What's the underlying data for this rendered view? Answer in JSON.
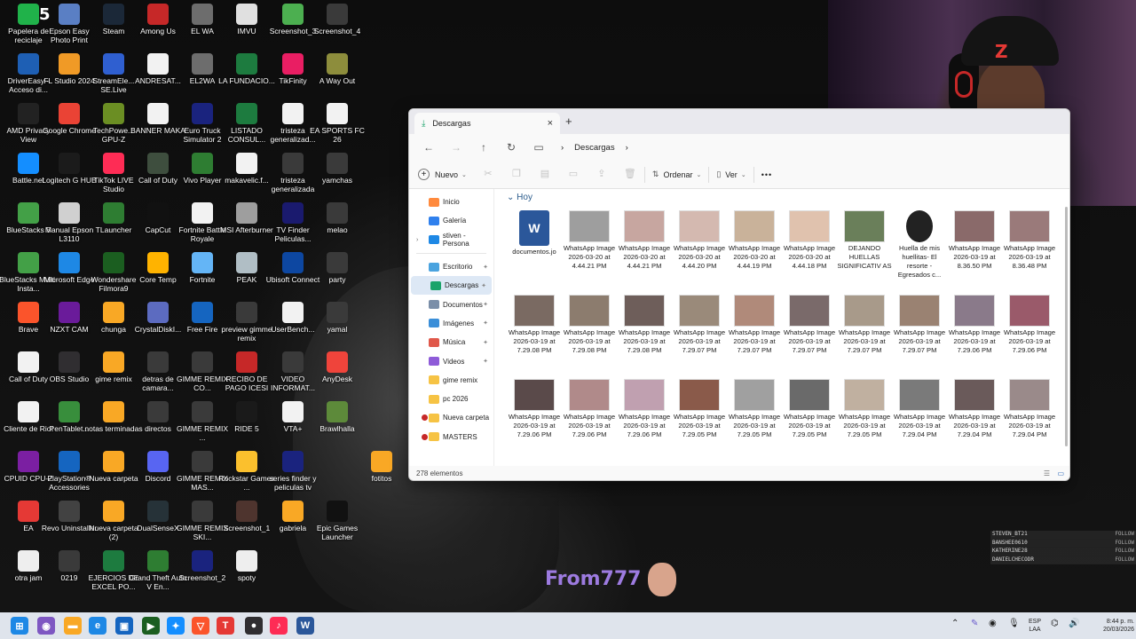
{
  "desktop": {
    "icons": [
      {
        "label": "Papelera de reciclaje",
        "badge": "5",
        "color": "#20b24a"
      },
      {
        "label": "Epson Easy Photo Print",
        "color": "#5a7fc4"
      },
      {
        "label": "Steam",
        "color": "#1b2838"
      },
      {
        "label": "Among Us",
        "color": "#c62828"
      },
      {
        "label": "EL WA",
        "color": "#6d6d6d"
      },
      {
        "label": "IMVU",
        "color": "#e0e0e0"
      },
      {
        "label": "Screenshot_3",
        "color": "#4caf50"
      },
      {
        "label": "Screenshot_4",
        "color": "#3a3a3a"
      },
      {
        "label": "DriverEasy - Acceso di...",
        "color": "#1e5fb4"
      },
      {
        "label": "FL Studio 2024",
        "color": "#f09a26"
      },
      {
        "label": "StreamEle... SE.Live",
        "color": "#2f5fd0"
      },
      {
        "label": "ANDRESAT...",
        "color": "#f2f2f2"
      },
      {
        "label": "EL2WA",
        "color": "#6d6d6d"
      },
      {
        "label": "LA FUNDACIO...",
        "color": "#1d7b3f"
      },
      {
        "label": "TikFinity",
        "color": "#e91e63"
      },
      {
        "label": "A Way Out",
        "color": "#8d8d3c"
      },
      {
        "label": "AMD Privacy View",
        "color": "#222222"
      },
      {
        "label": "Google Chrome",
        "color": "#ea4335"
      },
      {
        "label": "TechPowe... GPU-Z",
        "color": "#6b8e23"
      },
      {
        "label": "BANNER MAKA",
        "color": "#f2f2f2"
      },
      {
        "label": "Euro Truck Simulator 2",
        "color": "#1a237e"
      },
      {
        "label": "LISTADO CONSUL...",
        "color": "#1d7b3f"
      },
      {
        "label": "tristeza generalizad...",
        "color": "#f2f2f2"
      },
      {
        "label": "EA SPORTS FC 26",
        "color": "#f2f2f2"
      },
      {
        "label": "Battle.net",
        "color": "#148eff"
      },
      {
        "label": "Logitech G HUB",
        "color": "#1b1b1b"
      },
      {
        "label": "TikTok LIVE Studio",
        "color": "#fe2c55"
      },
      {
        "label": "Call of Duty",
        "color": "#3e4e3e"
      },
      {
        "label": "Vivo Player",
        "color": "#2e7d32"
      },
      {
        "label": "makavelic.f...",
        "color": "#f2f2f2"
      },
      {
        "label": "tristeza generalizada",
        "color": "#3a3a3a"
      },
      {
        "label": "yamchas",
        "color": "#3a3a3a"
      },
      {
        "label": "BlueStacks 5",
        "color": "#43a047"
      },
      {
        "label": "Manual Epson L3110",
        "color": "#d0d0d0"
      },
      {
        "label": "TLauncher",
        "color": "#2e7d32"
      },
      {
        "label": "CapCut",
        "color": "#111111"
      },
      {
        "label": "Fortnite Battle Royale",
        "color": "#f2f2f2"
      },
      {
        "label": "MSI Afterburner",
        "color": "#9e9e9e"
      },
      {
        "label": "TV Finder Peliculas...",
        "color": "#1a1a6e"
      },
      {
        "label": "melao",
        "color": "#3a3a3a"
      },
      {
        "label": "BlueStacks Multi-Insta...",
        "color": "#43a047"
      },
      {
        "label": "Microsoft Edge",
        "color": "#1e88e5"
      },
      {
        "label": "Wondershare Filmora9",
        "color": "#1b5e20"
      },
      {
        "label": "Core Temp",
        "color": "#ffb300"
      },
      {
        "label": "Fortnite",
        "color": "#64b5f6"
      },
      {
        "label": "PEAK",
        "color": "#b0bec5"
      },
      {
        "label": "Ubisoft Connect",
        "color": "#0d47a1"
      },
      {
        "label": "party",
        "color": "#3a3a3a"
      },
      {
        "label": "Brave",
        "color": "#fb542b"
      },
      {
        "label": "NZXT CAM",
        "color": "#6a1b9a"
      },
      {
        "label": "chunga",
        "color": "#f9a825"
      },
      {
        "label": "CrystalDiskI...",
        "color": "#5c6bc0"
      },
      {
        "label": "Free Fire",
        "color": "#1565c0"
      },
      {
        "label": "preview gimme remix",
        "color": "#3a3a3a"
      },
      {
        "label": "UserBench...",
        "color": "#f2f2f2"
      },
      {
        "label": "yamal",
        "color": "#3a3a3a"
      },
      {
        "label": "Call of Duty",
        "color": "#f2f2f2"
      },
      {
        "label": "OBS Studio",
        "color": "#302e31"
      },
      {
        "label": "gime remix",
        "color": "#f9a825"
      },
      {
        "label": "detras de camara...",
        "color": "#3a3a3a"
      },
      {
        "label": "GIMME REMIX CO...",
        "color": "#3a3a3a"
      },
      {
        "label": "RECIBO DE PAGO ICESI",
        "color": "#c62828"
      },
      {
        "label": "VIDEO INFORMAT...",
        "color": "#3a3a3a"
      },
      {
        "label": "AnyDesk",
        "color": "#ef443b"
      },
      {
        "label": "Cliente de Riot",
        "color": "#f2f2f2"
      },
      {
        "label": "PenTablet...",
        "color": "#388e3c"
      },
      {
        "label": "notas terminadas",
        "color": "#f9a825"
      },
      {
        "label": "directos",
        "color": "#3a3a3a"
      },
      {
        "label": "GIMME REMIX ...",
        "color": "#3a3a3a"
      },
      {
        "label": "RIDE 5",
        "color": "#1a1a1a"
      },
      {
        "label": "VTA+",
        "color": "#f2f2f2"
      },
      {
        "label": "Brawlhalla",
        "color": "#5d8a3a"
      },
      {
        "label": "CPUID CPU-Z",
        "color": "#7b1fa2"
      },
      {
        "label": "PlayStation® Accessories",
        "color": "#1565c0"
      },
      {
        "label": "Nueva carpeta",
        "color": "#f9a825"
      },
      {
        "label": "Discord",
        "color": "#5865f2"
      },
      {
        "label": "GIMME REMIX MAS...",
        "color": "#3a3a3a"
      },
      {
        "label": "Rockstar Games ...",
        "color": "#fbc02d"
      },
      {
        "label": "series finder y peliculas tv",
        "color": "#1a237e"
      },
      {
        "label": "fotitos",
        "color": "#f9a825"
      },
      {
        "label": "EA",
        "color": "#e53935"
      },
      {
        "label": "Revo Uninstaller",
        "color": "#424242"
      },
      {
        "label": "Nueva carpeta (2)",
        "color": "#f9a825"
      },
      {
        "label": "DualSenseX",
        "color": "#263238"
      },
      {
        "label": "GIMME REMIX SKI...",
        "color": "#3a3a3a"
      },
      {
        "label": "Screenshot_1",
        "color": "#4e342e"
      },
      {
        "label": "gabriela",
        "color": "#f9a825"
      },
      {
        "label": "Epic Games Launcher",
        "color": "#111111"
      },
      {
        "label": "otra jam",
        "color": "#eeeeee"
      },
      {
        "label": "0219",
        "color": "#3a3a3a"
      },
      {
        "label": "EJERCIOS DE EXCEL PO...",
        "color": "#1d7b3f"
      },
      {
        "label": "Grand Theft Auto V En...",
        "color": "#2e7d32"
      },
      {
        "label": "Screenshot_2",
        "color": "#1a237e"
      },
      {
        "label": "spoty",
        "color": "#eeeeee"
      }
    ]
  },
  "explorer": {
    "tab_title": "Descargas",
    "tab_close": "×",
    "new_tab": "+",
    "breadcrumb": "Descargas",
    "breadcrumb_sep": "›",
    "toolbar": {
      "new_label": "Nuevo",
      "sort_label": "Ordenar",
      "view_label": "Ver",
      "more": "•••"
    },
    "sidebar": [
      {
        "label": "Inicio",
        "color": "#ff8a3d"
      },
      {
        "label": "Galería",
        "color": "#2f80ed"
      },
      {
        "label": "stiven - Persona",
        "color": "#1e88e5",
        "caret": true
      },
      {
        "label": "Escritorio",
        "color": "#4aa3df",
        "pin": true
      },
      {
        "label": "Descargas",
        "color": "#1aa36a",
        "pin": true,
        "active": true
      },
      {
        "label": "Documentos",
        "color": "#7a8ea8",
        "pin": true
      },
      {
        "label": "Imágenes",
        "color": "#3a8ed8",
        "pin": true
      },
      {
        "label": "Música",
        "color": "#e0584a",
        "pin": true
      },
      {
        "label": "Videos",
        "color": "#8e5bd8",
        "pin": true
      },
      {
        "label": "gime remix",
        "color": "#f6c344"
      },
      {
        "label": "pc 2026",
        "color": "#f6c344"
      },
      {
        "label": "Nueva carpeta",
        "color": "#f6c344",
        "warn": true
      },
      {
        "label": "MASTERS",
        "color": "#f6c344",
        "warn": true
      }
    ],
    "group_header": "Hoy",
    "group_caret": "⌄",
    "files": [
      {
        "name": "documentos.jo",
        "color": "#2b579a"
      },
      {
        "name": "WhatsApp Image 2026-03-20 at 4.44.21 PM",
        "color": "#9e9e9e"
      },
      {
        "name": "WhatsApp Image 2026-03-20 at 4.44.21 PM",
        "color": "#c7a6a0"
      },
      {
        "name": "WhatsApp Image 2026-03-20 at 4.44.20 PM",
        "color": "#d4b9b0"
      },
      {
        "name": "WhatsApp Image 2026-03-20 at 4.44.19 PM",
        "color": "#c9b29a"
      },
      {
        "name": "WhatsApp Image 2026-03-20 at 4.44.18 PM",
        "color": "#e0c2ae"
      },
      {
        "name": "DEJANDO HUELLAS SIGNIFICATIV AS",
        "color": "#6a7f5a"
      },
      {
        "name": "Huella de mis huellitas- El resorte - Egresados c...",
        "color": "#222222"
      },
      {
        "name": "WhatsApp Image 2026-03-19 at 8.36.50 PM",
        "color": "#8a6a6a"
      },
      {
        "name": "WhatsApp Image 2026-03-19 at 8.36.48 PM",
        "color": "#9a7a7a"
      },
      {
        "name": "WhatsApp Image 2026-03-19 at 7.29.08 PM",
        "color": "#7a6a62"
      },
      {
        "name": "WhatsApp Image 2026-03-19 at 7.29.08 PM",
        "color": "#8c7c6e"
      },
      {
        "name": "WhatsApp Image 2026-03-19 at 7.29.08 PM",
        "color": "#6e5e5a"
      },
      {
        "name": "WhatsApp Image 2026-03-19 at 7.29.07 PM",
        "color": "#9a8a7a"
      },
      {
        "name": "WhatsApp Image 2026-03-19 at 7.29.07 PM",
        "color": "#b08a7a"
      },
      {
        "name": "WhatsApp Image 2026-03-19 at 7.29.07 PM",
        "color": "#7a6a6a"
      },
      {
        "name": "WhatsApp Image 2026-03-19 at 7.29.07 PM",
        "color": "#a89a8a"
      },
      {
        "name": "WhatsApp Image 2026-03-19 at 7.29.07 PM",
        "color": "#9a8272"
      },
      {
        "name": "WhatsApp Image 2026-03-19 at 7.29.06 PM",
        "color": "#8a7a8a"
      },
      {
        "name": "WhatsApp Image 2026-03-19 at 7.29.06 PM",
        "color": "#9a5a6a"
      },
      {
        "name": "WhatsApp Image 2026-03-19 at 7.29.06 PM",
        "color": "#5a4a4a"
      },
      {
        "name": "WhatsApp Image 2026-03-19 at 7.29.06 PM",
        "color": "#b08a8a"
      },
      {
        "name": "WhatsApp Image 2026-03-19 at 7.29.06 PM",
        "color": "#c0a0b0"
      },
      {
        "name": "WhatsApp Image 2026-03-19 at 7.29.05 PM",
        "color": "#8a5a4a"
      },
      {
        "name": "WhatsApp Image 2026-03-19 at 7.29.05 PM",
        "color": "#a0a0a0"
      },
      {
        "name": "WhatsApp Image 2026-03-19 at 7.29.05 PM",
        "color": "#6a6a6a"
      },
      {
        "name": "WhatsApp Image 2026-03-19 at 7.29.05 PM",
        "color": "#c0b0a0"
      },
      {
        "name": "WhatsApp Image 2026-03-19 at 7.29.04 PM",
        "color": "#7a7a7a"
      },
      {
        "name": "WhatsApp Image 2026-03-19 at 7.29.04 PM",
        "color": "#6a5a5a"
      },
      {
        "name": "WhatsApp Image 2026-03-19 at 7.29.04 PM",
        "color": "#9a8a8a"
      }
    ],
    "status": "278 elementos"
  },
  "overlay": {
    "alert_text": "From777",
    "chat": [
      {
        "user": "STEVEN_BT21",
        "action": "FOLLOW"
      },
      {
        "user": "BANSHEE0610",
        "action": "FOLLOW"
      },
      {
        "user": "KATHERINE28",
        "action": "FOLLOW"
      },
      {
        "user": "DANIELCHECODR",
        "action": "FOLLOW"
      }
    ]
  },
  "taskbar": {
    "pinned": [
      {
        "name": "start-button",
        "glyph": "⊞",
        "color": "#1e88e5"
      },
      {
        "name": "copilot",
        "glyph": "◉",
        "color": "#7e57c2"
      },
      {
        "name": "file-explorer",
        "glyph": "▬",
        "color": "#f9a825"
      },
      {
        "name": "edge",
        "glyph": "e",
        "color": "#1e88e5"
      },
      {
        "name": "store",
        "glyph": "▣",
        "color": "#1565c0"
      },
      {
        "name": "wondershare",
        "glyph": "▶",
        "color": "#1b5e20"
      },
      {
        "name": "battlenet",
        "glyph": "✦",
        "color": "#148eff"
      },
      {
        "name": "brave",
        "glyph": "▽",
        "color": "#fb542b"
      },
      {
        "name": "t-app",
        "glyph": "T",
        "color": "#e53935"
      },
      {
        "name": "obs",
        "glyph": "●",
        "color": "#302e31"
      },
      {
        "name": "tiktok",
        "glyph": "♪",
        "color": "#fe2c55"
      },
      {
        "name": "word",
        "glyph": "W",
        "color": "#2b579a"
      }
    ],
    "lang_top": "ESP",
    "lang_bottom": "LAA",
    "time": "8:44 p. m.",
    "date": "20/03/2026"
  }
}
